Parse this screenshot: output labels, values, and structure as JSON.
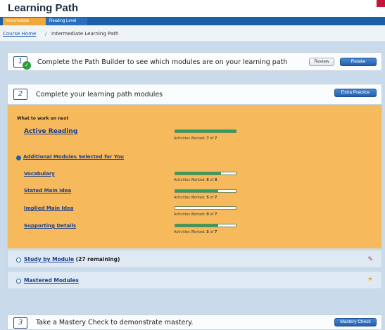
{
  "app": {
    "title": "Learning Path"
  },
  "tabs": [
    {
      "label": "Intermediate",
      "active": true
    },
    {
      "label": "Reading Level",
      "active": false
    }
  ],
  "breadcrumb": {
    "home": "Course Home",
    "separator": "/",
    "current": "Intermediate Learning Path"
  },
  "step1": {
    "number": "1",
    "text": "Complete the Path Builder to see which modules are on your learning path",
    "review_label": "Review",
    "retake_label": "Retake"
  },
  "step2": {
    "number": "2",
    "text": "Complete your learning path modules",
    "extra_practice_label": "Extra Practice",
    "next_heading": "What to work on next",
    "primary_module": {
      "name": "Active Reading",
      "worked_label": "Activities Worked:",
      "worked": "7",
      "of": "of",
      "total": "7",
      "progress": 1.0
    },
    "additional_heading": "Additional Modules Selected for You",
    "modules": [
      {
        "name": "Vocabulary",
        "worked_label": "Activities Worked:",
        "worked": "6",
        "of": "of",
        "total": "8",
        "progress": 0.75
      },
      {
        "name": "Stated Main Idea",
        "worked_label": "Activities Worked:",
        "worked": "5",
        "of": "of",
        "total": "7",
        "progress": 0.714
      },
      {
        "name": "Implied Main Idea",
        "worked_label": "Activities Worked:",
        "worked": "0",
        "of": "of",
        "total": "7",
        "progress": 0.0
      },
      {
        "name": "Supporting Details",
        "worked_label": "Activities Worked:",
        "worked": "5",
        "of": "of",
        "total": "7",
        "progress": 0.714
      }
    ],
    "study_by_module": "Study by Module",
    "study_remaining": "(27 remaining)",
    "mastered_modules": "Mastered Modules"
  },
  "step3": {
    "number": "3",
    "text": "Take a Mastery Check to demonstrate mastery.",
    "mastery_check_label": "Mastery Check"
  },
  "colors": {
    "tabbar": "#1d5ea8",
    "active_tab": "#f0a83a",
    "panel_orange": "#f6b95c",
    "progress_green": "#27a061",
    "link_blue": "#1b3f8c"
  },
  "icons": [
    "check-icon",
    "expand-circle-icon",
    "pencil-icon",
    "star-icon"
  ]
}
